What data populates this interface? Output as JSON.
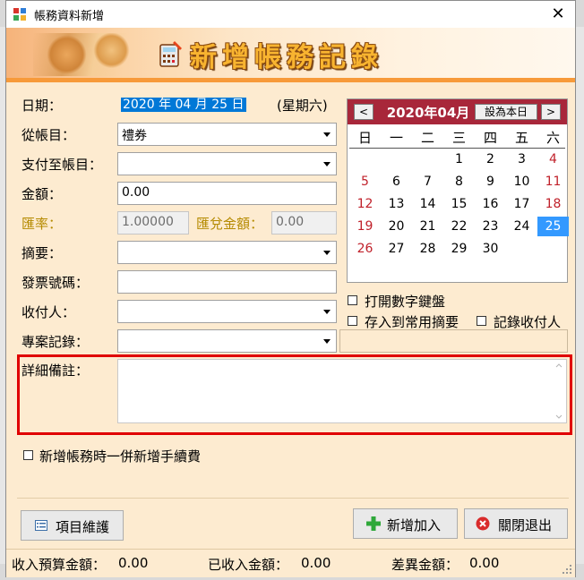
{
  "window": {
    "title": "帳務資料新增",
    "close_glyph": "✕"
  },
  "banner": {
    "title": "新增帳務記錄"
  },
  "form": {
    "date_label": "日期：",
    "date_value": "2020 年 04 月 25 日",
    "weekday": "(星期六)",
    "from_account_label": "從帳目：",
    "from_account_value": "禮券",
    "pay_to_label": "支付至帳目：",
    "pay_to_value": "",
    "amount_label": "金額：",
    "amount_value": "0.00",
    "rate_label": "匯率：",
    "rate_value": "1.00000",
    "exchange_amount_label": "匯兌金額：",
    "exchange_amount_value": "0.00",
    "summary_label": "摘要：",
    "summary_value": "",
    "invoice_label": "發票號碼：",
    "invoice_value": "",
    "payee_label": "收付人：",
    "payee_value": "",
    "project_label": "專案記錄：",
    "project_value": "",
    "notes_label": "詳細備註：",
    "notes_value": ""
  },
  "calendar": {
    "prev": "<",
    "next": ">",
    "month_title": "2020年04月",
    "today_button": "設為本日",
    "weekdays": [
      "日",
      "一",
      "二",
      "三",
      "四",
      "五",
      "六"
    ],
    "selected_day": "25",
    "weeks": [
      [
        "",
        "",
        "",
        "1",
        "2",
        "3",
        "4"
      ],
      [
        "5",
        "6",
        "7",
        "8",
        "9",
        "10",
        "11"
      ],
      [
        "12",
        "13",
        "14",
        "15",
        "16",
        "17",
        "18"
      ],
      [
        "19",
        "20",
        "21",
        "22",
        "23",
        "24",
        "25"
      ],
      [
        "26",
        "27",
        "28",
        "29",
        "30",
        "",
        ""
      ]
    ]
  },
  "options": {
    "open_keypad": "打開數字鍵盤",
    "save_common_summary": "存入到常用摘要",
    "record_payee": "記錄收付人",
    "add_fee": "新增帳務時一併新增手續費"
  },
  "buttons": {
    "maintain": "項目維護",
    "add": "新增加入",
    "close": "關閉退出"
  },
  "status": {
    "budget_label": "收入預算金額：",
    "budget_value": "0.00",
    "received_label": "已收入金額：",
    "received_value": "0.00",
    "diff_label": "差異金額：",
    "diff_value": "0.00"
  },
  "colors": {
    "window_bg": "#fdebd0",
    "calendar_header": "#a8273a",
    "selection_blue": "#0078d7",
    "highlight_border": "#e00000",
    "banner_title": "#f8b430"
  }
}
